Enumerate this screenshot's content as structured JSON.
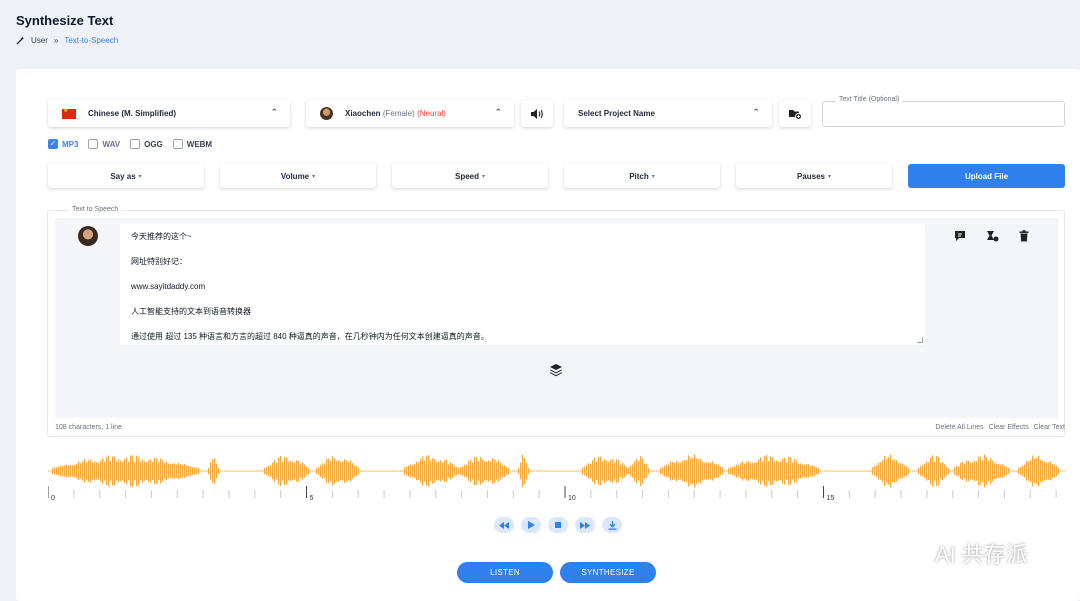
{
  "header": {
    "title": "Synthesize Text",
    "breadcrumb": {
      "root": "User",
      "separator": "»",
      "current": "Text-to-Speech"
    }
  },
  "selectors": {
    "language": "Chinese (M. Simplified)",
    "voice_name": "Xiaochen",
    "voice_gender": "(Female)",
    "voice_type": "(Neural)",
    "project": "Select Project Name",
    "text_title_label": "Text Title (Optional)"
  },
  "formats": [
    {
      "label": "MP3",
      "checked": true
    },
    {
      "label": "WAV",
      "checked": false
    },
    {
      "label": "OGG",
      "checked": false
    },
    {
      "label": "WEBM",
      "checked": false
    }
  ],
  "effects": {
    "say_as": "Say as",
    "volume": "Volume",
    "speed": "Speed",
    "pitch": "Pitch",
    "pauses": "Pauses",
    "upload": "Upload File"
  },
  "tts": {
    "section_label": "Text to Speech",
    "lines": [
      "今天推荐的这个~",
      "网址特别好记：",
      "www.sayitdaddy.com",
      "人工智能支持的文本到语音转换器",
      "通过使用 超过 135 种语言和方言的超过 840 种逼真的声音，在几秒钟内为任何文本创建逼真的声音。"
    ],
    "char_count": "108 characters, 1 line",
    "actions": [
      "Delete All Lines",
      "Clear Effects",
      "Clear Text"
    ]
  },
  "waveform": {
    "color": "#f2a93b",
    "ticks": [
      "0",
      "5",
      "10",
      "15"
    ]
  },
  "player": {
    "icons": [
      "rewind-icon",
      "play-icon",
      "stop-icon",
      "fast-forward-icon",
      "download-icon"
    ]
  },
  "buttons": {
    "listen": "LISTEN",
    "synthesize": "SYNTHESIZE"
  },
  "watermark": {
    "text": "AI 共存派"
  },
  "colors": {
    "accent": "#2f80ed",
    "neural": "#ef4444"
  }
}
